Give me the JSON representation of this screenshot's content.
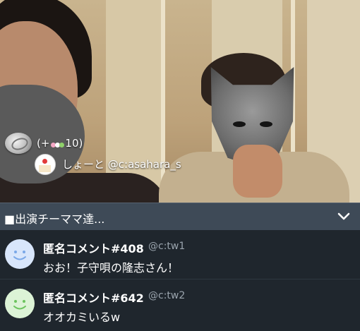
{
  "stream": {
    "scene_label": "live video stream"
  },
  "gift": {
    "icon": "coin-icon",
    "count_text": "(+",
    "item_icon": "dango-icon",
    "count_value": "10)",
    "user_avatar_icon": "cake-avatar-icon",
    "user_name": "しょーと",
    "user_handle": "@c:asahara_s"
  },
  "header": {
    "title": "■出演チーママ達...",
    "chevron_icon": "chevron-down-icon",
    "colors": {
      "background": "#3e4a57"
    }
  },
  "comments": [
    {
      "name": "匿名コメント#408",
      "handle": "@c:tw1",
      "text": "おお！子守唄の隆志さん！",
      "avatar_color": "#d8e6fb",
      "face_color": "#7aa8e8"
    },
    {
      "name": "匿名コメント#642",
      "handle": "@c:tw2",
      "text": "オオカミいるw",
      "avatar_color": "#dcf3d6",
      "face_color": "#6cc45e"
    }
  ]
}
